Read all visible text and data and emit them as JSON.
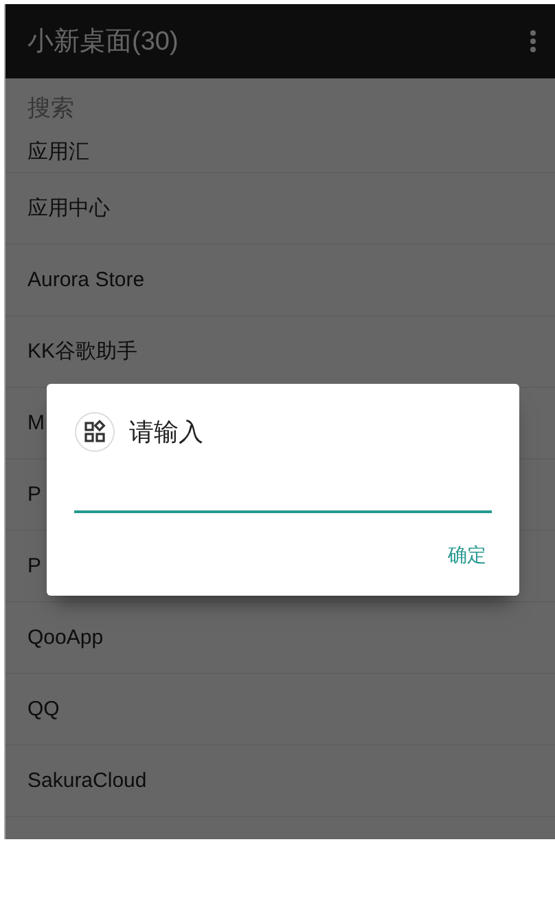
{
  "app_bar": {
    "title": "小新桌面(30)"
  },
  "search": {
    "placeholder": "搜索"
  },
  "apps": [
    {
      "name": "应用汇"
    },
    {
      "name": "应用中心"
    },
    {
      "name": "Aurora Store"
    },
    {
      "name": "KK谷歌助手"
    },
    {
      "name": "M"
    },
    {
      "name": "P"
    },
    {
      "name": "P"
    },
    {
      "name": "QooApp"
    },
    {
      "name": "QQ"
    },
    {
      "name": "SakuraCloud"
    }
  ],
  "dialog": {
    "title": "请输入",
    "input_focused": true,
    "buttons": [
      "确定"
    ]
  }
}
